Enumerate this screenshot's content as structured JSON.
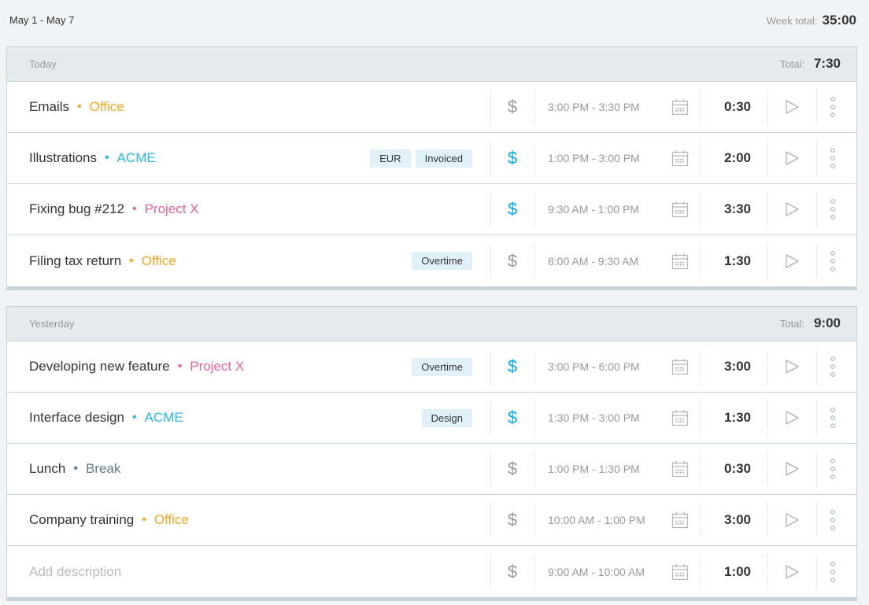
{
  "week": {
    "range": "May 1 - May 7",
    "total_label": "Week total:",
    "total": "35:00"
  },
  "colors": {
    "office": "#f5a623",
    "acme": "#29b6e8",
    "project_x": "#f06292",
    "break": "#607d8b",
    "billable_on": "#03a9f4",
    "billable_off": "#999999"
  },
  "days": [
    {
      "title": "Today",
      "total_label": "Total:",
      "total": "7:30",
      "entries": [
        {
          "description": "Emails",
          "project": "Office",
          "project_color": "#f5a623",
          "tags": [],
          "billable": false,
          "time_range": "3:00 PM - 3:30 PM",
          "duration": "0:30"
        },
        {
          "description": "Illustrations",
          "project": "ACME",
          "project_color": "#29b6e8",
          "tags": [
            "EUR",
            "Invoiced"
          ],
          "billable": true,
          "time_range": "1:00 PM - 3:00 PM",
          "duration": "2:00"
        },
        {
          "description": "Fixing bug #212",
          "project": "Project X",
          "project_color": "#f06292",
          "tags": [],
          "billable": true,
          "time_range": "9:30 AM - 1:00 PM",
          "duration": "3:30"
        },
        {
          "description": "Filing tax return",
          "project": "Office",
          "project_color": "#f5a623",
          "tags": [
            "Overtime"
          ],
          "billable": false,
          "time_range": "8:00 AM - 9:30 AM",
          "duration": "1:30"
        }
      ]
    },
    {
      "title": "Yesterday",
      "total_label": "Total:",
      "total": "9:00",
      "entries": [
        {
          "description": "Developing new feature",
          "project": "Project X",
          "project_color": "#f06292",
          "tags": [
            "Overtime"
          ],
          "billable": true,
          "time_range": "3:00 PM - 6:00 PM",
          "duration": "3:00"
        },
        {
          "description": "Interface design",
          "project": "ACME",
          "project_color": "#29b6e8",
          "tags": [
            "Design"
          ],
          "billable": true,
          "time_range": "1:30 PM - 3:00 PM",
          "duration": "1:30"
        },
        {
          "description": "Lunch",
          "project": "Break",
          "project_color": "#607d8b",
          "tags": [],
          "billable": false,
          "time_range": "1:00 PM - 1:30 PM",
          "duration": "0:30"
        },
        {
          "description": "Company training",
          "project": "Office",
          "project_color": "#f5a623",
          "tags": [],
          "billable": false,
          "time_range": "10:00 AM - 1:00 PM",
          "duration": "3:00"
        },
        {
          "description": "",
          "placeholder": "Add description",
          "project": "",
          "project_color": "",
          "tags": [],
          "billable": false,
          "time_range": "9:00 AM - 10:00 AM",
          "duration": "1:00"
        }
      ]
    }
  ],
  "icons": {
    "billable": "dollar-icon",
    "calendar": "calendar-icon",
    "play": "play-icon",
    "more": "more-vertical-icon"
  }
}
